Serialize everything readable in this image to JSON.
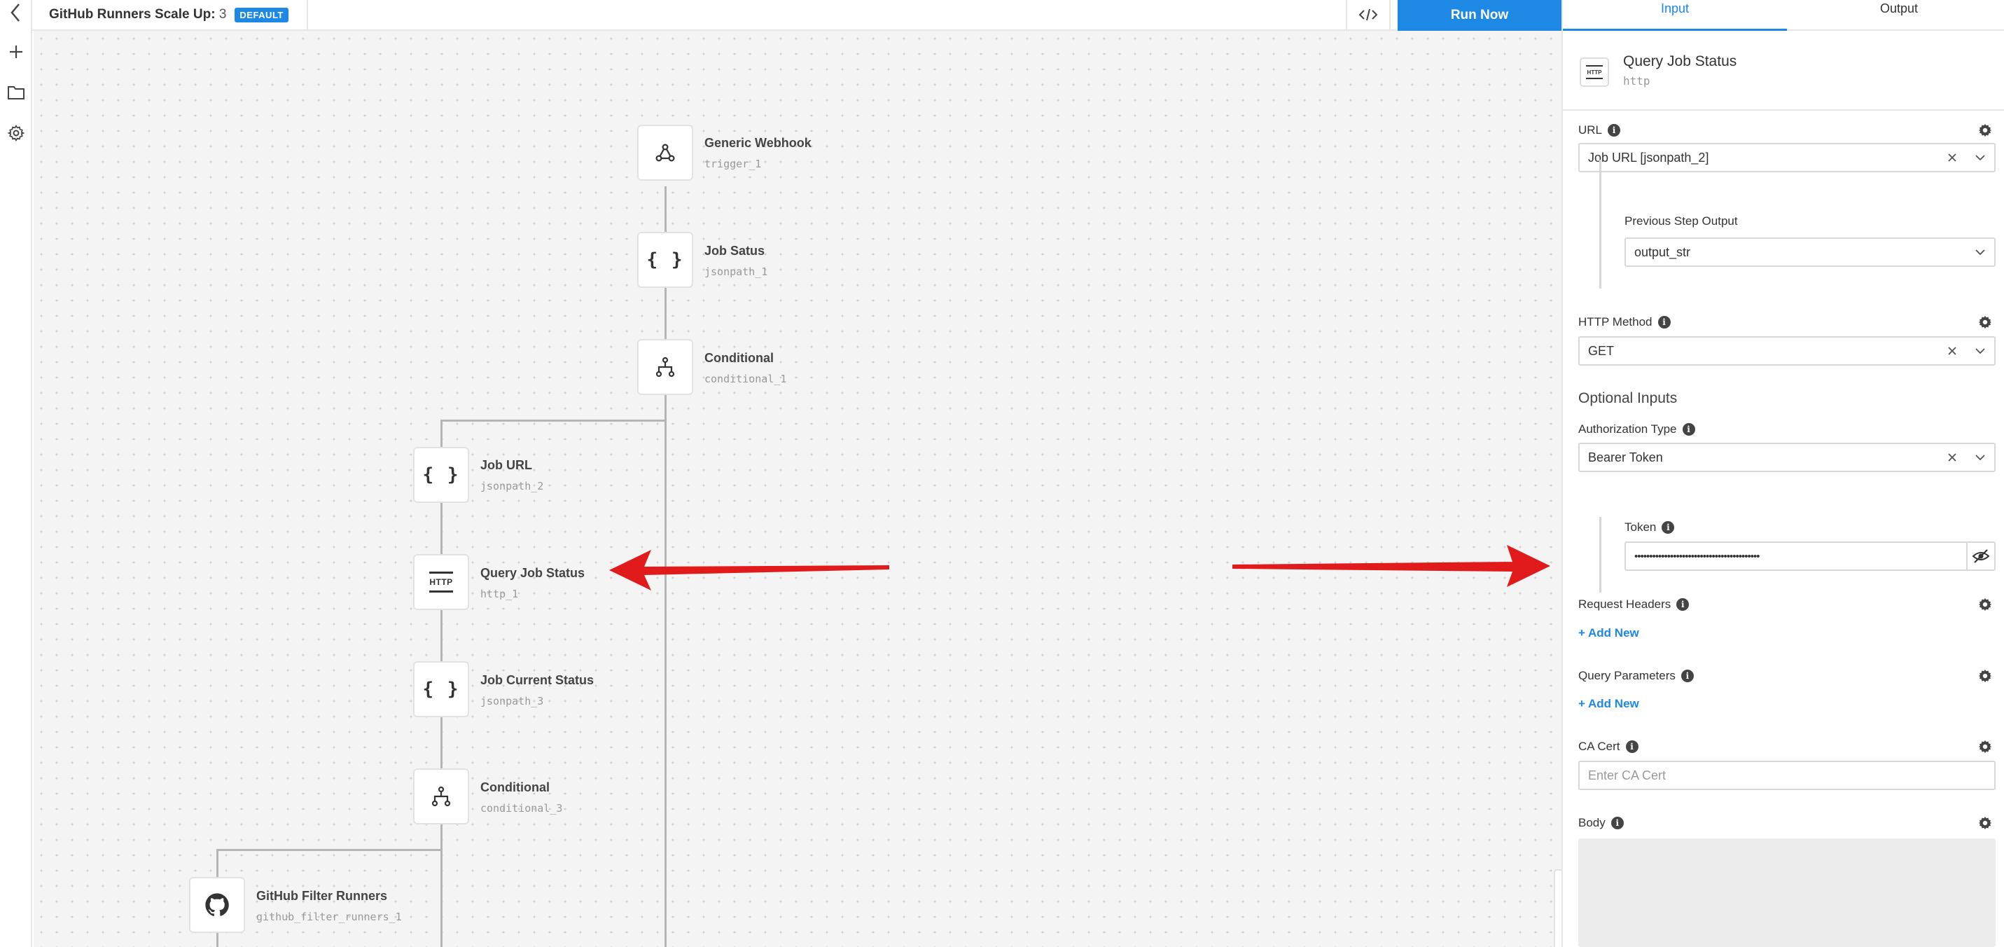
{
  "header": {
    "title": "GitHub Runners Scale Up:",
    "version": "3",
    "badge": "DEFAULT",
    "run_label": "Run Now"
  },
  "nodes": [
    {
      "name": "Generic Webhook",
      "id": "trigger_1",
      "icon": "webhook-icon"
    },
    {
      "name": "Job Satus",
      "id": "jsonpath_1",
      "icon": "json-braces-icon"
    },
    {
      "name": "Conditional",
      "id": "conditional_1",
      "icon": "branch-icon"
    },
    {
      "name": "Job URL",
      "id": "jsonpath_2",
      "icon": "json-braces-icon"
    },
    {
      "name": "Query Job Status",
      "id": "http_1",
      "icon": "http-icon"
    },
    {
      "name": "Job Current Status",
      "id": "jsonpath_3",
      "icon": "json-braces-icon"
    },
    {
      "name": "Conditional",
      "id": "conditional_3",
      "icon": "branch-icon"
    },
    {
      "name": "GitHub Filter Runners",
      "id": "github_filter_runners_1",
      "icon": "github-icon"
    }
  ],
  "glyphs": {
    "json": "{ }",
    "http": "HTTP"
  },
  "zoom": {
    "in": "+",
    "out": "−"
  },
  "panel": {
    "tabs": [
      {
        "label": "Input"
      },
      {
        "label": "Output"
      }
    ],
    "step": {
      "name": "Query Job Status",
      "type": "http"
    },
    "url": {
      "label": "URL",
      "value": "Job URL [jsonpath_2]"
    },
    "prev_output": {
      "label": "Previous Step Output",
      "value": "output_str"
    },
    "method": {
      "label": "HTTP Method",
      "value": "GET"
    },
    "optional_title": "Optional Inputs",
    "auth": {
      "label": "Authorization Type",
      "value": "Bearer Token"
    },
    "token": {
      "label": "Token",
      "value": "••••••••••••••••••••••••••••••••••••••••••"
    },
    "headers": {
      "label": "Request Headers",
      "add": "+ Add New"
    },
    "params": {
      "label": "Query Parameters",
      "add": "+ Add New"
    },
    "ca_cert": {
      "label": "CA Cert",
      "placeholder": "Enter CA Cert"
    },
    "body": {
      "label": "Body"
    }
  },
  "colors": {
    "accent": "#1e88e5",
    "annotation_arrow": "#e11b1b"
  }
}
